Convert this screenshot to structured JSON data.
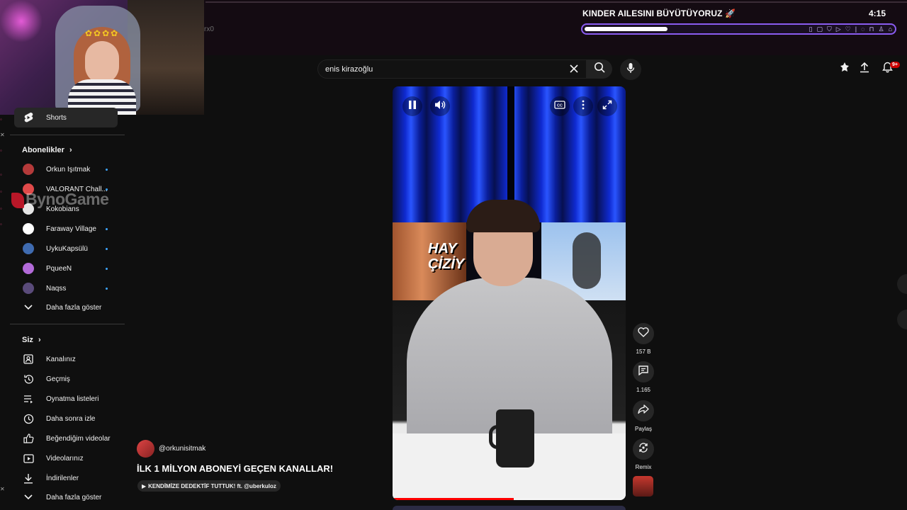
{
  "stream": {
    "title": "KINDER AILESINI BÜYÜTÜYORUZ 🚀",
    "time": "4:15",
    "progress_fraction": 0.27,
    "side_text": "rx0"
  },
  "search": {
    "value": "enis kirazoğlu"
  },
  "sidebar": {
    "shorts_label": "Shorts",
    "subs_heading": "Abonelikler",
    "subscriptions": [
      {
        "label": "Orkun Işıtmak",
        "color": "#b43a3a"
      },
      {
        "label": "VALORANT Chall...",
        "color": "#e04a4a"
      },
      {
        "label": "Kokobians",
        "color": "#e6e6e6"
      },
      {
        "label": "Faraway Village",
        "color": "#ffffff"
      },
      {
        "label": "UykuKapsülü",
        "color": "#3f6bb0"
      },
      {
        "label": "PqueeN",
        "color": "#b26ad8"
      },
      {
        "label": "Naqss",
        "color": "#5a4b7a"
      }
    ],
    "show_more_subs": "Daha fazla göster",
    "you_heading": "Siz",
    "you_items": [
      {
        "label": "Kanalınız",
        "icon": "channel-icon"
      },
      {
        "label": "Geçmiş",
        "icon": "history-icon"
      },
      {
        "label": "Oynatma listeleri",
        "icon": "playlists-icon"
      },
      {
        "label": "Daha sonra izle",
        "icon": "watch-later-icon"
      },
      {
        "label": "Beğendiğim videolar",
        "icon": "like-icon"
      },
      {
        "label": "Videolarınız",
        "icon": "your-videos-icon"
      },
      {
        "label": "İndirilenler",
        "icon": "download-icon"
      }
    ],
    "show_more_you": "Daha fazla göster"
  },
  "watermark": "BynoGame",
  "video": {
    "overlay_text": "HAY\nÇİZİY",
    "progress_fraction": 0.52
  },
  "actions": {
    "likes": "157 B",
    "comments": "1.165",
    "share": "Paylaş",
    "remix": "Remix"
  },
  "notifications": {
    "badge": "9+"
  },
  "info": {
    "handle": "@orkunisitmak",
    "title": "İLK 1 MİLYON ABONEYİ GEÇEN KANALLAR!",
    "chip": "KENDİMİZE DEDEKTİF TUTTUK! ft. @uberkuloz"
  },
  "colors": {
    "accent_purple": "#8a5cf0",
    "badge_red": "#cc0000",
    "progress_red": "#ff0000"
  }
}
